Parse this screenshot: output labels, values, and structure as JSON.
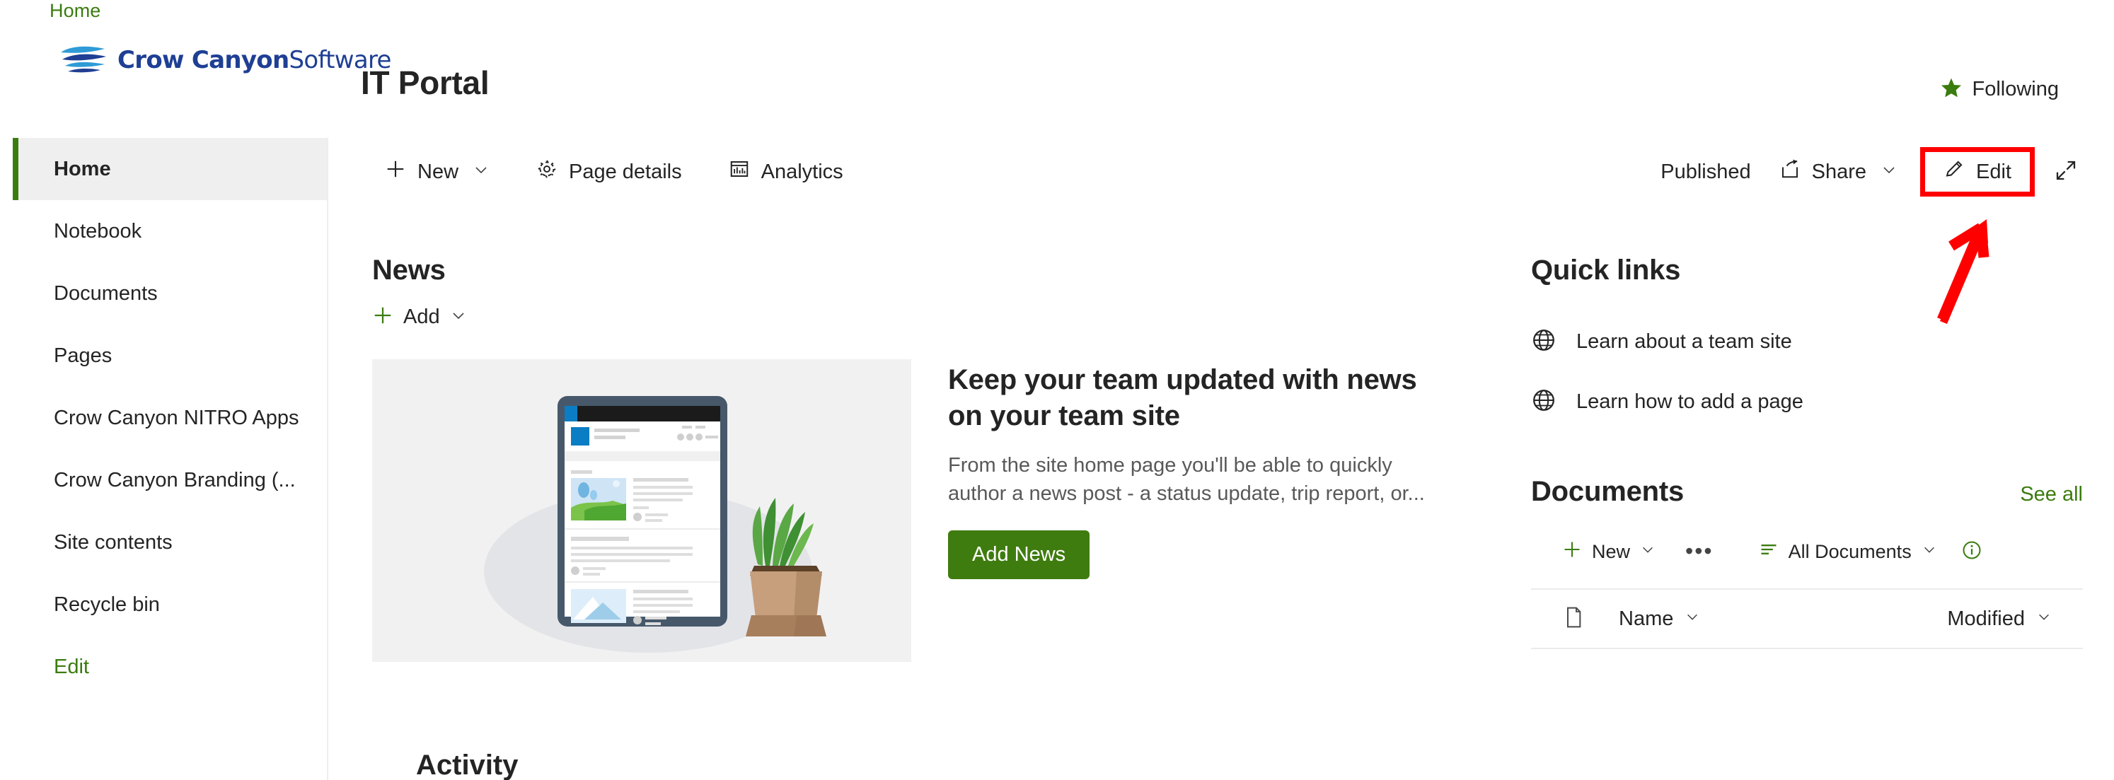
{
  "breadcrumb": {
    "home": "Home"
  },
  "brand": {
    "name_bold": "Crow Canyon",
    "name_light": "Software",
    "logo_icon": "wave-swoosh-icon",
    "logo_color": "#1F3F94"
  },
  "header": {
    "site_title": "IT Portal",
    "following_label": "Following",
    "following_icon": "star-filled-icon",
    "following_icon_color": "#3b7c0f"
  },
  "sidebar": {
    "items": [
      {
        "label": "Home",
        "selected": true
      },
      {
        "label": "Notebook",
        "selected": false
      },
      {
        "label": "Documents",
        "selected": false
      },
      {
        "label": "Pages",
        "selected": false
      },
      {
        "label": "Crow Canyon NITRO Apps",
        "selected": false
      },
      {
        "label": "Crow Canyon Branding (...",
        "selected": false
      },
      {
        "label": "Site contents",
        "selected": false
      },
      {
        "label": "Recycle bin",
        "selected": false
      }
    ],
    "edit_label": "Edit",
    "accent_color": "#3b7c0f",
    "selected_bg": "#efefef"
  },
  "command_bar": {
    "new_label": "New",
    "new_icon": "plus-icon",
    "new_chevron": "chevron-down-icon",
    "page_details_label": "Page details",
    "page_details_icon": "gear-icon",
    "analytics_label": "Analytics",
    "analytics_icon": "bar-chart-icon",
    "published_label": "Published",
    "share_label": "Share",
    "share_icon": "share-icon",
    "share_chevron": "chevron-down-icon",
    "edit_label": "Edit",
    "edit_icon": "pencil-icon",
    "edit_highlight_color": "#FF0000",
    "expand_icon": "expand-diagonal-icon"
  },
  "annotation": {
    "arrow_icon": "red-arrow-up-right-icon",
    "arrow_color": "#FF0000",
    "target": "edit-button"
  },
  "news": {
    "heading": "News",
    "add_label": "Add",
    "add_icon": "plus-icon",
    "add_chevron": "chevron-down-icon",
    "article": {
      "title": "Keep your team updated with news on your team site",
      "description": "From the site home page you'll be able to quickly author a news post - a status update, trip report, or...",
      "thumbnail_icon": "tablet-news-illustration",
      "cta_label": "Add News",
      "cta_color": "#3f7c0f"
    }
  },
  "activity": {
    "heading": "Activity"
  },
  "quick_links": {
    "heading": "Quick links",
    "items": [
      {
        "label": "Learn about a team site",
        "icon": "globe-icon"
      },
      {
        "label": "Learn how to add a page",
        "icon": "globe-icon"
      }
    ]
  },
  "documents": {
    "heading": "Documents",
    "see_all_label": "See all",
    "toolbar": {
      "new_label": "New",
      "new_icon": "plus-icon",
      "new_chevron": "chevron-down-icon",
      "ellipsis_label": "•••",
      "view_label": "All Documents",
      "view_icon": "filter-list-icon",
      "view_chevron": "chevron-down-icon",
      "info_icon": "info-circle-icon"
    },
    "columns": [
      {
        "label": "Name",
        "chevron": "chevron-down-icon"
      },
      {
        "label": "Modified",
        "chevron": "chevron-down-icon"
      }
    ],
    "file_icon": "document-icon",
    "rows": []
  }
}
